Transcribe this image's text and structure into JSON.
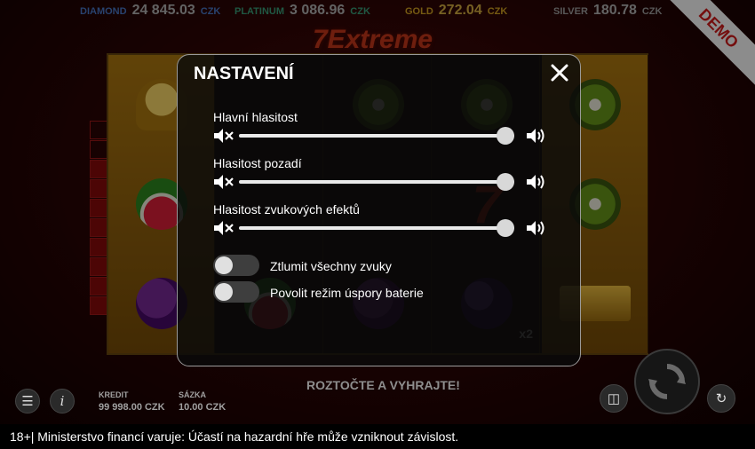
{
  "jackpots": [
    {
      "name": "DIAMOND",
      "value": "24 845.03",
      "currency": "CZK",
      "color": "#4a78c8"
    },
    {
      "name": "PLATINUM",
      "value": "3 086.96",
      "currency": "CZK",
      "color": "#3aa07a"
    },
    {
      "name": "GOLD",
      "value": "272.04",
      "currency": "CZK",
      "color": "#d6a422"
    },
    {
      "name": "SILVER",
      "value": "180.78",
      "currency": "CZK",
      "color": "#a0a0a0"
    }
  ],
  "logo": "7Extreme",
  "demo_badge": "DEMO",
  "reels": {
    "symbols": [
      [
        "bell-icon",
        "watermelon-icon",
        "grapes-icon"
      ],
      [
        "cherry-icon",
        "watermelon-icon",
        "watermelon-icon"
      ],
      [
        "kiwi-icon",
        "bar-icon",
        "grapes-icon"
      ],
      [
        "kiwi-icon",
        "seven-icon",
        "plum-icon"
      ],
      [
        "kiwi-icon",
        "kiwi-icon",
        "bar-icon"
      ]
    ],
    "multiplier": "x2"
  },
  "settings": {
    "title": "NASTAVENÍ",
    "sliders": [
      {
        "label": "Hlavní hlasitost",
        "value": 1.0
      },
      {
        "label": "Hlasitost pozadí",
        "value": 1.0
      },
      {
        "label": "Hlasitost zvukových efektů",
        "value": 1.0
      }
    ],
    "toggles": [
      {
        "label": "Ztlumit všechny zvuky",
        "on": false
      },
      {
        "label": "Povolit režim úspory baterie",
        "on": false
      }
    ]
  },
  "bottom": {
    "credit_label": "KREDIT",
    "credit_value": "99 998.00 CZK",
    "bet_label": "SÁZKA",
    "bet_value": "10.00 CZK",
    "message": "ROZTOČTE A VYHRAJTE!"
  },
  "footer": "18+| Ministerstvo financí varuje: Účastí na hazardní hře může vzniknout závislost."
}
